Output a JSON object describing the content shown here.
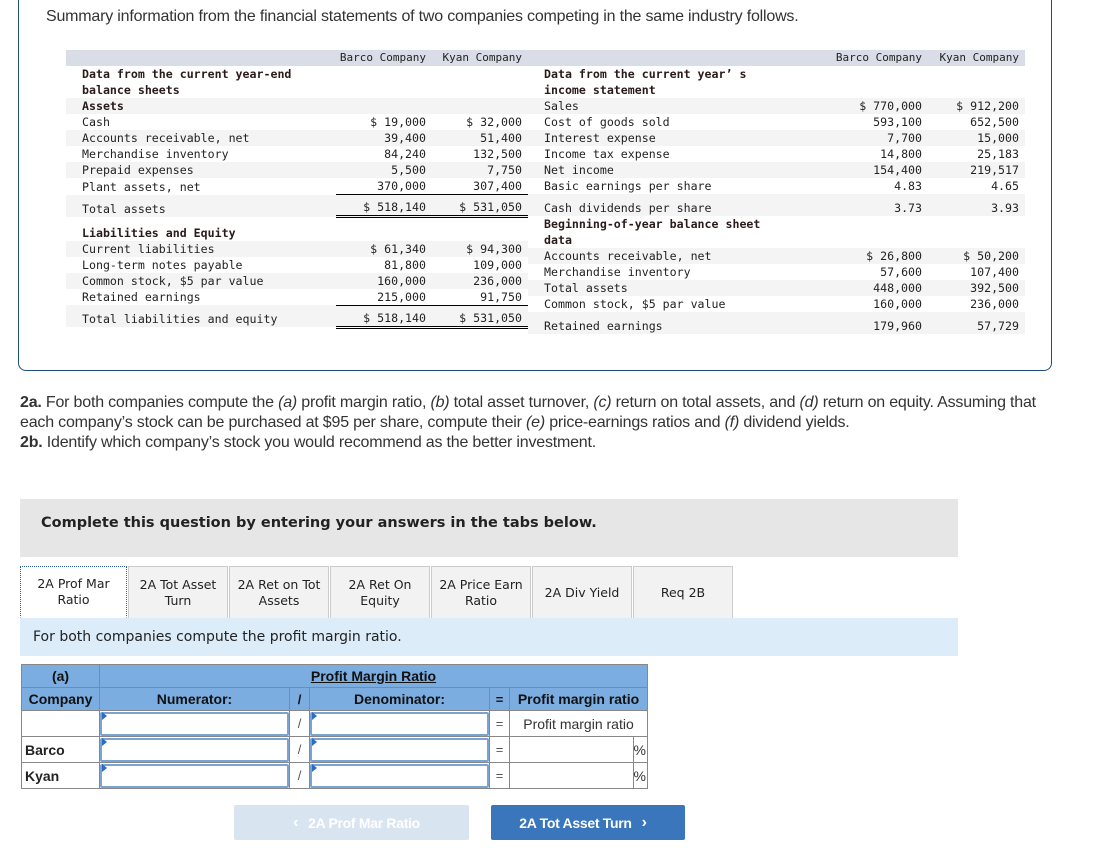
{
  "intro": "Summary information from the financial statements of two companies competing in the same industry follows.",
  "columns": {
    "barco": "Barco Company",
    "kyan": "Kyan Company"
  },
  "balance_sheet": {
    "title_line1": "Data from the current year-end",
    "title_line2": "balance sheets",
    "assets_heading": "Assets",
    "assets": [
      {
        "label": "Cash",
        "barco": "$ 19,000",
        "kyan": "$ 32,000"
      },
      {
        "label": "Accounts receivable, net",
        "barco": "39,400",
        "kyan": "51,400"
      },
      {
        "label": "Merchandise inventory",
        "barco": "84,240",
        "kyan": "132,500"
      },
      {
        "label": "Prepaid expenses",
        "barco": "5,500",
        "kyan": "7,750"
      },
      {
        "label": "Plant assets, net",
        "barco": "370,000",
        "kyan": "307,400"
      }
    ],
    "total_assets": {
      "label": "Total assets",
      "barco": "$ 518,140",
      "kyan": "$ 531,050"
    },
    "liab_heading": "Liabilities and Equity",
    "liabilities": [
      {
        "label": "Current liabilities",
        "barco": "$ 61,340",
        "kyan": "$ 94,300"
      },
      {
        "label": "Long-term notes payable",
        "barco": "81,800",
        "kyan": "109,000"
      },
      {
        "label": "Common stock, $5 par value",
        "barco": "160,000",
        "kyan": "236,000"
      },
      {
        "label": "Retained earnings",
        "barco": "215,000",
        "kyan": "91,750"
      }
    ],
    "total_liab": {
      "label": "Total liabilities and equity",
      "barco": "$ 518,140",
      "kyan": "$ 531,050"
    }
  },
  "income_statement": {
    "title_line1": "Data from the current year’ s",
    "title_line2": "income statement",
    "rows": [
      {
        "label": "Sales",
        "barco": "$ 770,000",
        "kyan": "$ 912,200"
      },
      {
        "label": "Cost of goods sold",
        "barco": "593,100",
        "kyan": "652,500"
      },
      {
        "label": "Interest expense",
        "barco": "7,700",
        "kyan": "15,000"
      },
      {
        "label": "Income tax expense",
        "barco": "14,800",
        "kyan": "25,183"
      },
      {
        "label": "Net income",
        "barco": "154,400",
        "kyan": "219,517"
      },
      {
        "label": "Basic earnings per share",
        "barco": "4.83",
        "kyan": "4.65"
      },
      {
        "label": "Cash dividends per share",
        "barco": "3.73",
        "kyan": "3.93"
      }
    ]
  },
  "beginning_year": {
    "title_line1": "Beginning-of-year balance sheet",
    "title_line2": "data",
    "rows": [
      {
        "label": "Accounts receivable, net",
        "barco": "$ 26,800",
        "kyan": "$ 50,200"
      },
      {
        "label": "Merchandise inventory",
        "barco": "57,600",
        "kyan": "107,400"
      },
      {
        "label": "Total assets",
        "barco": "448,000",
        "kyan": "392,500"
      },
      {
        "label": "Common stock, $5 par value",
        "barco": "160,000",
        "kyan": "236,000"
      },
      {
        "label": "Retained earnings",
        "barco": "179,960",
        "kyan": "57,729"
      }
    ]
  },
  "question": {
    "q2a_label": "2a.",
    "q2a_t1": " For both companies compute the ",
    "a": "(a)",
    "a_t": " profit margin ratio, ",
    "b": "(b)",
    "b_t": " total asset turnover, ",
    "c": "(c)",
    "c_t": " return on total assets, and ",
    "d": "(d)",
    "d_t": " return on equity. Assuming that each company’s stock can be purchased at $95 per share, compute their ",
    "e": "(e)",
    "e_t": " price-earnings ratios and ",
    "f": "(f)",
    "f_t": " dividend yields.",
    "q2b_label": "2b.",
    "q2b_text": " Identify which company’s stock you would recommend as the better investment."
  },
  "instructions": "Complete this question by entering your answers in the tabs below.",
  "tabs": [
    {
      "line1": "2A Prof Mar",
      "line2": "Ratio",
      "active": true
    },
    {
      "line1": "2A Tot Asset",
      "line2": "Turn"
    },
    {
      "line1": "2A Ret on Tot",
      "line2": "Assets"
    },
    {
      "line1": "2A Ret On",
      "line2": "Equity"
    },
    {
      "line1": "2A Price Earn",
      "line2": "Ratio"
    },
    {
      "line1": "2A Div Yield",
      "line2": ""
    },
    {
      "line1": "Req 2B",
      "line2": ""
    }
  ],
  "sub_instructions": "For both companies compute the profit margin ratio.",
  "answer_table": {
    "part": "(a)",
    "title": "Profit Margin Ratio",
    "col_company": "Company",
    "col_numerator": "Numerator:",
    "div_symbol": "/",
    "col_denominator": "Denominator:",
    "eq_symbol": "=",
    "col_result": "Profit margin ratio",
    "row0_result": "Profit margin ratio",
    "rows": [
      {
        "company": "Barco",
        "numerator": "",
        "denominator": "",
        "result": "",
        "unit": "%"
      },
      {
        "company": "Kyan",
        "numerator": "",
        "denominator": "",
        "result": "",
        "unit": "%"
      }
    ]
  },
  "nav": {
    "prev_label": "2A Prof Mar Ratio",
    "next_label": "2A Tot Asset Turn",
    "prev_icon": "‹",
    "next_icon": "›"
  }
}
